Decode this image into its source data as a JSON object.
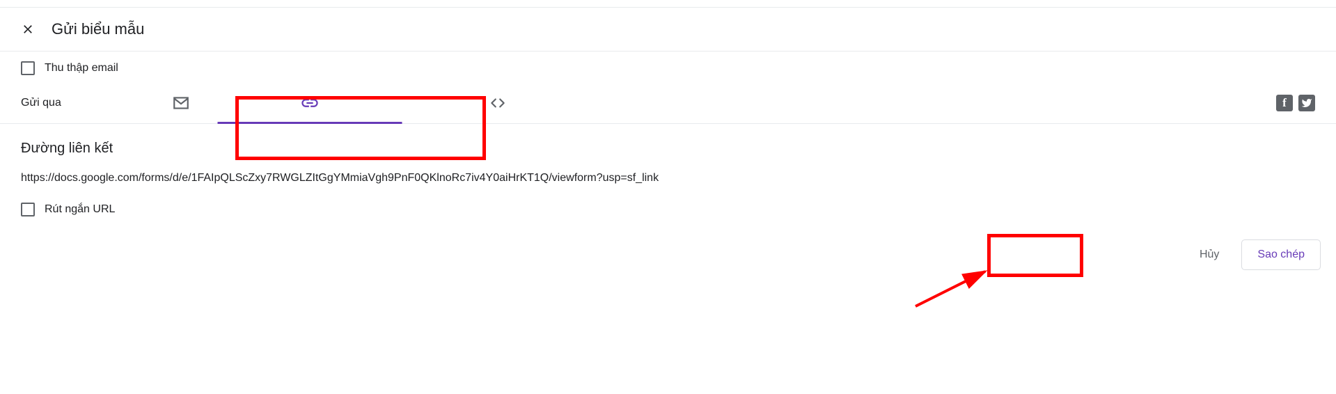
{
  "header": {
    "title": "Gửi biểu mẫu"
  },
  "collect": {
    "label": "Thu thập email"
  },
  "sendvia": {
    "label": "Gửi qua"
  },
  "linkSection": {
    "heading": "Đường liên kết",
    "url": "https://docs.google.com/forms/d/e/1FAIpQLScZxy7RWGLZItGgYMmiaVgh9PnF0QKlnoRc7iv4Y0aiHrKT1Q/viewform?usp=sf_link"
  },
  "shorten": {
    "label": "Rút ngắn URL"
  },
  "actions": {
    "cancel": "Hủy",
    "copy": "Sao chép"
  },
  "social": {
    "fb": "f",
    "tw": "t"
  }
}
